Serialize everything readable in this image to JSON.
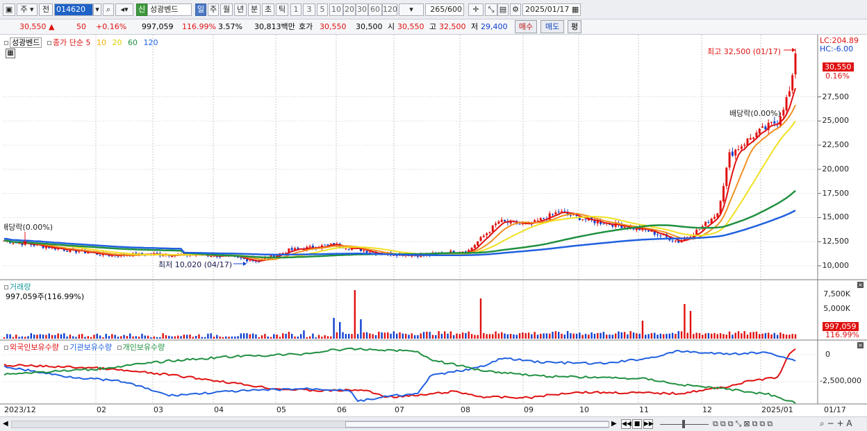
{
  "toolbar": {
    "market": "주",
    "prev_label": "전",
    "code": "014620",
    "new_badge": "신",
    "stock_name": "성광벤드",
    "periods": [
      "일",
      "주",
      "월",
      "년",
      "분",
      "초",
      "틱"
    ],
    "active_period": "일",
    "intervals": [
      "1",
      "3",
      "5",
      "10",
      "20",
      "30",
      "60",
      "120"
    ],
    "count": "265",
    "count_total": "/600",
    "date": "2025/01/17"
  },
  "quote": {
    "price": "30,550",
    "change": "50",
    "change_pct": "+0.16%",
    "volume": "997,059",
    "volume_ratio": "116.99%",
    "turnover_pct": "3.57%",
    "amount": "30,813백만",
    "hoga_label": "호가",
    "ask": "30,550",
    "bid": "30,500",
    "open_label": "시",
    "open": "30,550",
    "high_label": "고",
    "high": "32,500",
    "low_label": "저",
    "low": "29,400",
    "buy_btn": "매수",
    "sell_btn": "매도",
    "eval_btn": "평"
  },
  "price_pane": {
    "legend_name": "성광벤드",
    "legend_ma": "종가 단순",
    "ma_periods": [
      "5",
      "10",
      "20",
      "60",
      "120"
    ],
    "ma_colors": [
      "#e01010",
      "#f09020",
      "#f0e020",
      "#209040",
      "#2060e0"
    ],
    "lc": "LC:204.89",
    "hc": "HC:-6.00",
    "last_price_tag": "30,550",
    "last_pct": "0.16%",
    "y_ticks": [
      "27,500",
      "25,000",
      "22,500",
      "20,000",
      "17,500",
      "15,000",
      "12,500",
      "10,000"
    ],
    "ann_high": "최고 32,500 (01/17)",
    "ann_low": "최저 10,020 (04/17)",
    "ann_div_right": "배당락(0.00%)",
    "ann_div_left": "배당락(0.00%)"
  },
  "volume_pane": {
    "title": "거래량",
    "value": "997,059주(116.99%)",
    "y_ticks": [
      "7,500K",
      "5,000K"
    ],
    "tag": "997,059",
    "tag_pct": "116.99%"
  },
  "holdings_pane": {
    "legend": [
      {
        "name": "외국인보유수량",
        "color": "#e01010"
      },
      {
        "name": "기관보유수량",
        "color": "#2060e0"
      },
      {
        "name": "개인보유수량",
        "color": "#209040"
      }
    ],
    "y_ticks": [
      "0",
      "-2,500,000"
    ]
  },
  "x_axis": {
    "labels": [
      "2023/12",
      "02",
      "03",
      "04",
      "05",
      "06",
      "07",
      "08",
      "09",
      "10",
      "11",
      "12",
      "2025/01"
    ],
    "end_label": "01/17"
  }
}
